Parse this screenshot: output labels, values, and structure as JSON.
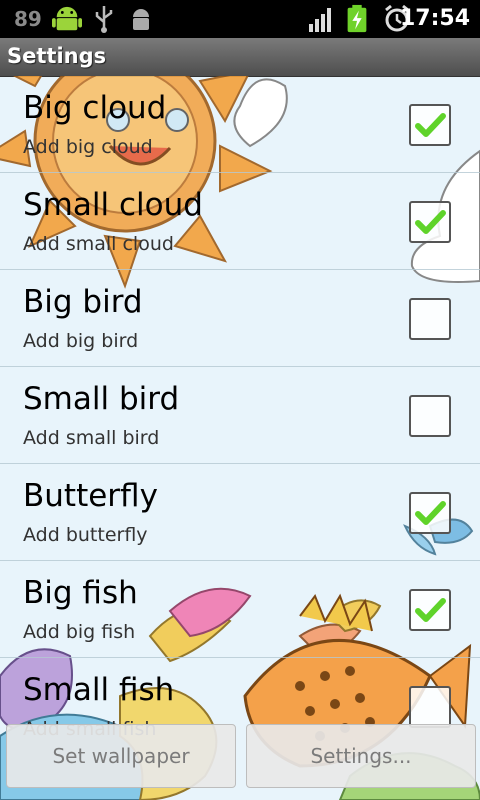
{
  "status_bar": {
    "battery_percent": "89",
    "time": "17:54",
    "icons": [
      "android-icon",
      "usb-icon",
      "debug-icon",
      "signal-icon",
      "battery-charging-icon",
      "alarm-icon"
    ]
  },
  "title_bar": {
    "title": "Settings"
  },
  "settings": [
    {
      "title": "Big cloud",
      "summary": "Add big cloud",
      "checked": true
    },
    {
      "title": "Small cloud",
      "summary": "Add small cloud",
      "checked": true
    },
    {
      "title": "Big bird",
      "summary": "Add big bird",
      "checked": false
    },
    {
      "title": "Small bird",
      "summary": "Add small bird",
      "checked": false
    },
    {
      "title": "Butterfly",
      "summary": "Add butterfly",
      "checked": true
    },
    {
      "title": "Big fish",
      "summary": "Add big fish",
      "checked": true
    },
    {
      "title": "Small fish",
      "summary": "Add small fish",
      "checked": false
    }
  ],
  "buttons": {
    "set_wallpaper": "Set wallpaper",
    "settings": "Settings..."
  },
  "colors": {
    "check_green": "#5fd32a",
    "background": "#e8f4fb"
  }
}
